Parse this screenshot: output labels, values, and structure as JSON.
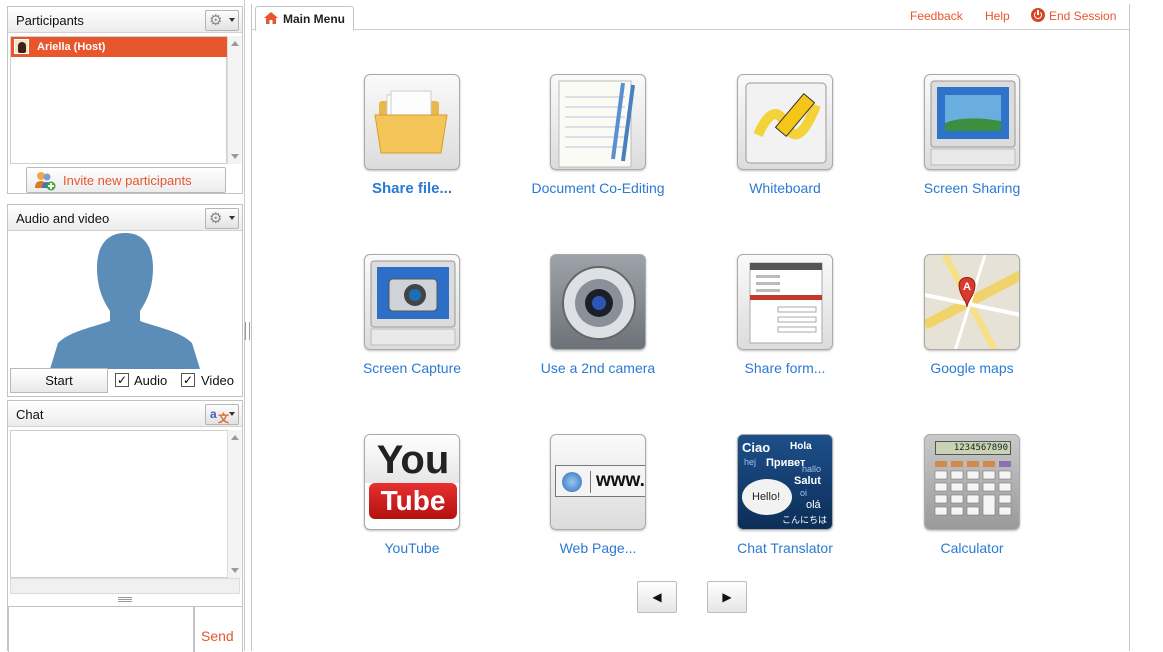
{
  "left": {
    "participants": {
      "title": "Participants",
      "items": [
        {
          "name": "Ariella (Host)"
        }
      ],
      "invite_label": "Invite new participants"
    },
    "audio_video": {
      "title": "Audio and video",
      "start_label": "Start",
      "audio_label": "Audio",
      "video_label": "Video",
      "audio_checked": "✓",
      "video_checked": "✓"
    },
    "chat": {
      "title": "Chat",
      "send_label": "Send"
    }
  },
  "main": {
    "tab_label": "Main Menu",
    "links": {
      "feedback": "Feedback",
      "help": "Help",
      "end_session": "End Session"
    },
    "apps": [
      {
        "label": "Share file...",
        "icon": "folder-icon"
      },
      {
        "label": "Document Co-Editing",
        "icon": "notepad-icon"
      },
      {
        "label": "Whiteboard",
        "icon": "whiteboard-icon"
      },
      {
        "label": "Screen Sharing",
        "icon": "monitor-icon"
      },
      {
        "label": "Screen Capture",
        "icon": "screen-camera-icon"
      },
      {
        "label": "Use a 2nd camera",
        "icon": "webcam-icon"
      },
      {
        "label": "Share form...",
        "icon": "form-icon"
      },
      {
        "label": "Google maps",
        "icon": "map-icon"
      },
      {
        "label": "YouTube",
        "icon": "youtube-icon",
        "icon_text_top": "You",
        "icon_text_bottom": "Tube"
      },
      {
        "label": "Web Page...",
        "icon": "browser-icon",
        "icon_text": "www."
      },
      {
        "label": "Chat Translator",
        "icon": "translator-icon",
        "icon_words": [
          "Ciao",
          "Hola",
          "hej",
          "Привет",
          "hallo",
          "Hello!",
          "Salut",
          "oi",
          "olá",
          "こんにちは"
        ]
      },
      {
        "label": "Calculator",
        "icon": "calculator-icon",
        "display": "1234567890"
      }
    ],
    "pager": {
      "prev": "◀",
      "next": "▶"
    }
  },
  "colors": {
    "accent": "#e8562e",
    "link": "#2a7ad1"
  }
}
